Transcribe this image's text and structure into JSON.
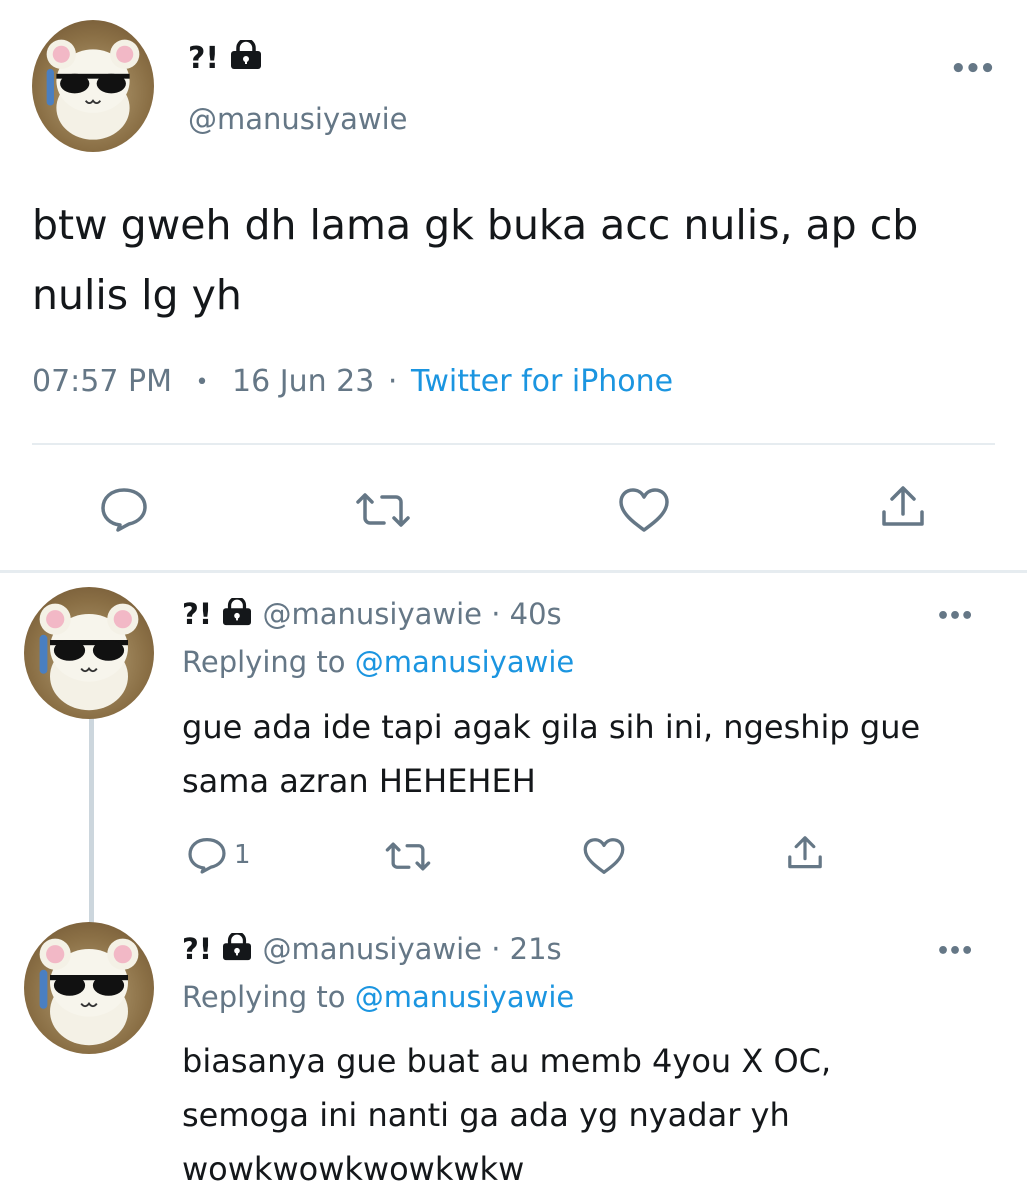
{
  "main_tweet": {
    "display_name": "?!",
    "handle": "@manusiyawie",
    "text_line1": "btw gweh dh lama gk buka acc nulis, ap cb",
    "text_line2": "nulis lg yh",
    "time": "07:57 PM",
    "separator": "•",
    "date": "16 Jun 23",
    "dot": "·",
    "source": "Twitter for iPhone",
    "more": "•••"
  },
  "reply1": {
    "display_name": "?!",
    "handle": "@manusiyawie",
    "age": "· 40s",
    "replying_label": "Replying to",
    "replying_to": "@manusiyawie",
    "text_line1": "gue ada ide tapi agak gila sih ini, ngeship gue",
    "text_line2": "sama azran HEHEHEH",
    "reply_count": "1",
    "more": "•••"
  },
  "reply2": {
    "display_name": "?!",
    "handle": "@manusiyawie",
    "age": "· 21s",
    "replying_label": "Replying to",
    "replying_to": "@manusiyawie",
    "text_line1": "biasanya gue buat au memb 4you X OC,",
    "text_line2": "semoga ini nanti ga ada yg nyadar yh",
    "text_line3": "wowkwowkwowkwkw",
    "more": "•••"
  },
  "colors": {
    "link_blue": "#1b95e0",
    "meta_gray": "#657786",
    "divider": "#e6ecf0",
    "thread_line": "#ccd6dd"
  },
  "icons": [
    "avatar-hamster-sunglasses",
    "lock-icon",
    "more-icon",
    "reply-icon",
    "retweet-icon",
    "like-icon",
    "share-icon"
  ]
}
